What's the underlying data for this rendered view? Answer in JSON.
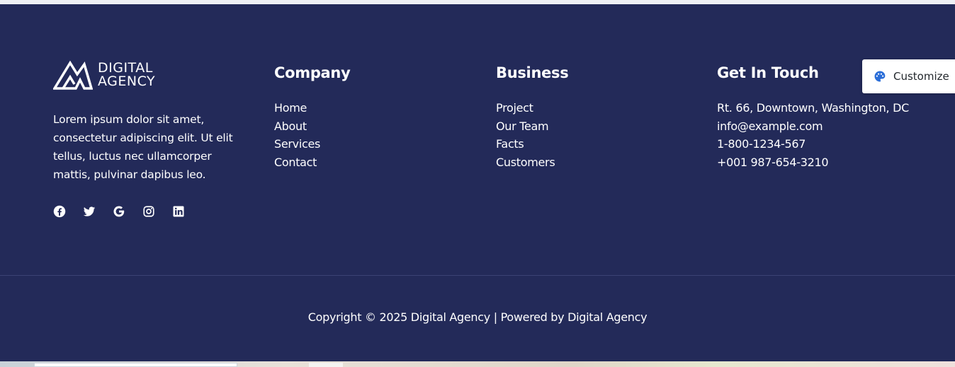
{
  "brand": {
    "logo_line1": "DIGITAL",
    "logo_line2": "AGENCY",
    "description": "Lorem ipsum dolor sit amet, consectetur adipiscing elit. Ut elit tellus, luctus nec ullamcorper mattis, pulvinar dapibus leo.",
    "social_icons": [
      "facebook-icon",
      "twitter-icon",
      "google-icon",
      "instagram-icon",
      "linkedin-icon"
    ]
  },
  "company": {
    "title": "Company",
    "links": [
      "Home",
      "About",
      "Services",
      "Contact"
    ]
  },
  "business": {
    "title": "Business",
    "links": [
      "Project",
      "Our Team",
      "Facts",
      "Customers"
    ]
  },
  "contact": {
    "title": "Get In Touch",
    "items": [
      "Rt. 66, Downtown, Washington, DC",
      "info@example.com",
      "1-800-1234-567",
      "+001 987-654-3210"
    ]
  },
  "copyright": "Copyright © 2025 Digital Agency | Powered by Digital Agency",
  "customize": {
    "label": "Customize",
    "icon": "palette-icon",
    "icon_color": "#2b6ed8"
  },
  "colors": {
    "footer_bg": "#232a59",
    "text": "#ffffff"
  }
}
